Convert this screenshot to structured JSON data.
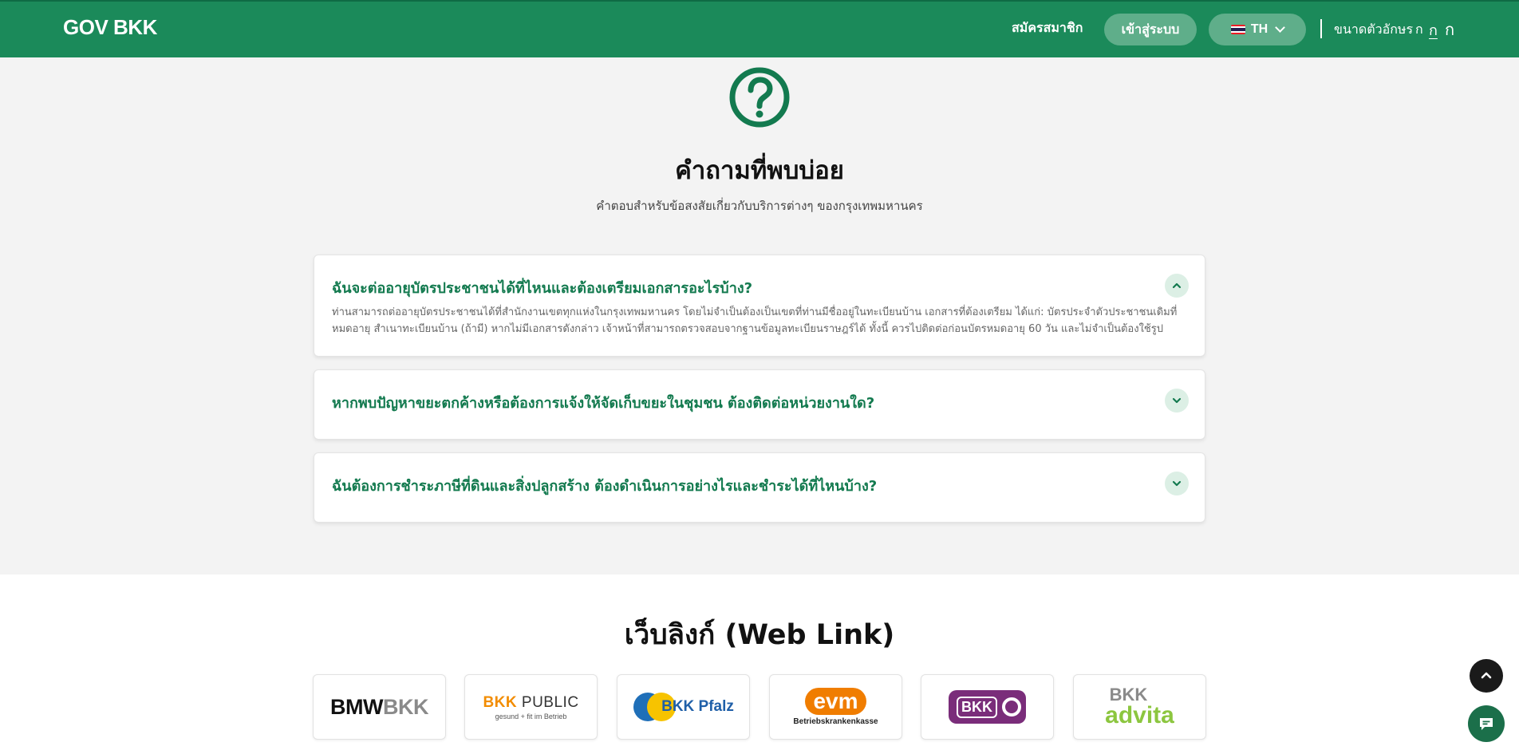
{
  "header": {
    "brand": "GOV BKK",
    "register": "สมัครสมาชิก",
    "login": "เข้าสู่ระบบ",
    "language": "TH",
    "font_size_label": "ขนาดตัวอักษร",
    "font_size_options": [
      "ก",
      "ก",
      "ก"
    ]
  },
  "faq": {
    "title": "คำถามที่พบบ่อย",
    "subtitle": "คำตอบสำหรับข้อสงสัยเกี่ยวกับบริการต่างๆ ของกรุงเทพมหานคร",
    "items": [
      {
        "question": "ฉันจะต่ออายุบัตรประชาชนได้ที่ไหนและต้องเตรียมเอกสารอะไรบ้าง?",
        "answer": "ท่านสามารถต่ออายุบัตรประชาชนได้ที่สำนักงานเขตทุกแห่งในกรุงเทพมหานคร โดยไม่จำเป็นต้องเป็นเขตที่ท่านมีชื่ออยู่ในทะเบียนบ้าน เอกสารที่ต้องเตรียม ได้แก่: บัตรประจำตัวประชาชนเดิมที่หมดอายุ สำเนาทะเบียนบ้าน (ถ้ามี) หากไม่มีเอกสารดังกล่าว เจ้าหน้าที่สามารถตรวจสอบจากฐานข้อมูลทะเบียนราษฎร์ได้ ทั้งนี้ ควรไปติดต่อก่อนบัตรหมดอายุ 60 วัน และไม่จำเป็นต้องใช้รูปถ่าย",
        "expanded": true
      },
      {
        "question": "หากพบปัญหาขยะตกค้างหรือต้องการแจ้งให้จัดเก็บขยะในชุมชน ต้องติดต่อหน่วยงานใด?",
        "expanded": false
      },
      {
        "question": "ฉันต้องการชำระภาษีที่ดินและสิ่งปลูกสร้าง ต้องดำเนินการอย่างไรและชำระได้ที่ไหนบ้าง?",
        "expanded": false
      }
    ]
  },
  "weblinks": {
    "title": "เว็บลิงก์ (Web Link)",
    "logos": [
      {
        "name": "BMW BKK",
        "part1": "BMW",
        "part2": "BKK"
      },
      {
        "name": "BKK PUBLIC",
        "part1": "BKK",
        "part2": "PUBLIC",
        "tagline": "gesund + fit im Betrieb"
      },
      {
        "name": "BKK Pfalz",
        "text": "BKK Pfalz"
      },
      {
        "name": "evm Betriebskrankenkasse",
        "mark": "evm",
        "text": "Betriebskrankenkasse"
      },
      {
        "name": "BKK",
        "text": "BKK"
      },
      {
        "name": "BKK advita",
        "part1": "BKK",
        "part2": "advita"
      }
    ]
  },
  "colors": {
    "primary": "#1b8a5a",
    "primary_dark": "#137a4f",
    "button_bg": "#5fae8a",
    "faq_bg": "#f3f3f3"
  }
}
